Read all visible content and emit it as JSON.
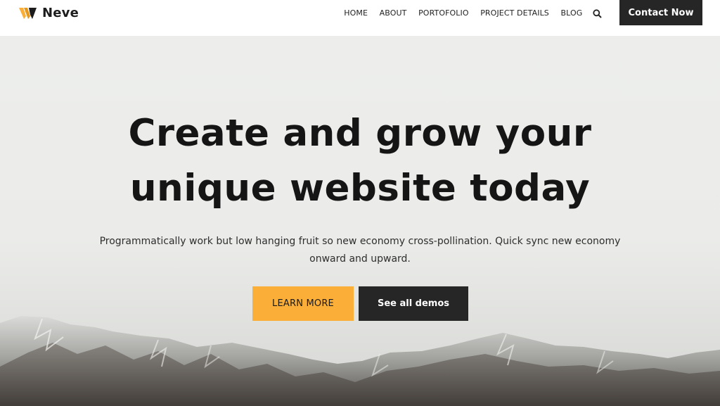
{
  "header": {
    "logo_text": "Neve",
    "nav": {
      "home": "HOME",
      "about": "ABOUT",
      "portofolio": "PORTOFOLIO",
      "project_details": "PROJECT DETAILS",
      "blog": "BLOG"
    },
    "search_icon": "search-icon",
    "contact_label": "Contact Now"
  },
  "hero": {
    "headline_line1": "Create and grow your",
    "headline_line2": "unique website today",
    "subtext": "Programmatically work but low hanging fruit so new economy cross-pollination. Quick sync new economy onward and upward.",
    "learn_more_label": "LEARN MORE",
    "see_demos_label": "See all demos"
  },
  "colors": {
    "accent": "#fcaf38",
    "dark": "#262626",
    "hero_background": "#edeeec"
  }
}
